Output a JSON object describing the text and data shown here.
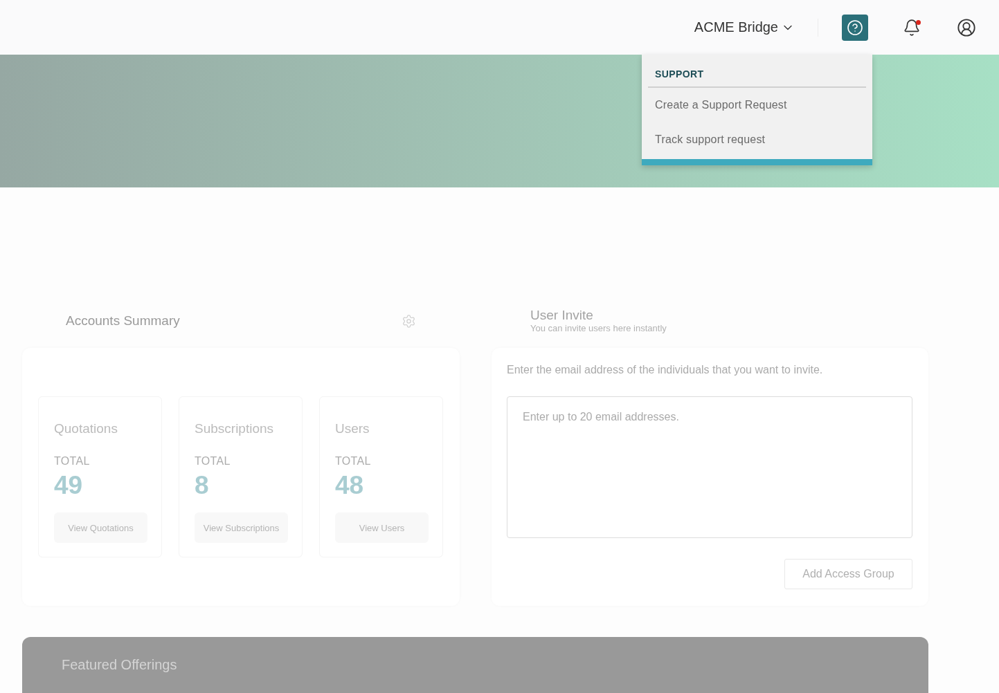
{
  "header": {
    "account": {
      "label": "ACME Bridge"
    },
    "help_button": {
      "expanded": true,
      "menu": {
        "heading": "SUPPORT",
        "items": [
          "Create a Support Request",
          "Track support request"
        ]
      }
    },
    "notifications": {
      "unread": true
    }
  },
  "accounts_summary": {
    "title": "Accounts Summary",
    "stats": [
      {
        "title": "Quotations",
        "total_label": "TOTAL",
        "value": "49",
        "action": "View Quotations"
      },
      {
        "title": "Subscriptions",
        "total_label": "TOTAL",
        "value": "8",
        "action": "View Subscriptions"
      },
      {
        "title": "Users",
        "total_label": "TOTAL",
        "value": "48",
        "action": "View Users"
      }
    ]
  },
  "user_invite": {
    "title": "User Invite",
    "subtitle": "You can invite users here instantly",
    "instructions": "Enter the email address of the individuals that you want to invite.",
    "emails": {
      "placeholder": "Enter up to 20 email addresses."
    },
    "add_button": {
      "label": "Add Access Group",
      "disabled": true
    }
  },
  "featured": {
    "title": "Featured Offerings"
  }
}
